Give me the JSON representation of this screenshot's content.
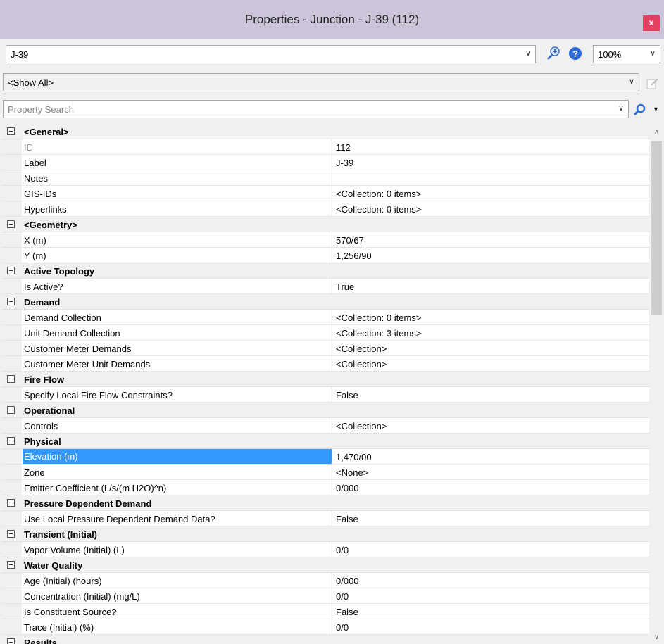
{
  "window": {
    "title": "Properties - Junction - J-39 (112)",
    "close_label": "x"
  },
  "toolbar": {
    "element_selector_value": "J-39",
    "zoom_value": "100%",
    "filter_value": "<Show All>",
    "search_placeholder": "Property Search"
  },
  "rows": [
    {
      "type": "category",
      "name": "<General>"
    },
    {
      "type": "property",
      "name": "ID",
      "value": "112",
      "disabled": true
    },
    {
      "type": "property",
      "name": "Label",
      "value": "J-39"
    },
    {
      "type": "property",
      "name": "Notes",
      "value": ""
    },
    {
      "type": "property",
      "name": "GIS-IDs",
      "value": "<Collection: 0 items>"
    },
    {
      "type": "property",
      "name": "Hyperlinks",
      "value": "<Collection: 0 items>"
    },
    {
      "type": "category",
      "name": "<Geometry>"
    },
    {
      "type": "property",
      "name": "X (m)",
      "value": "570/67"
    },
    {
      "type": "property",
      "name": "Y (m)",
      "value": "1,256/90"
    },
    {
      "type": "category",
      "name": "Active Topology"
    },
    {
      "type": "property",
      "name": "Is Active?",
      "value": "True"
    },
    {
      "type": "category",
      "name": "Demand"
    },
    {
      "type": "property",
      "name": "Demand Collection",
      "value": "<Collection: 0 items>"
    },
    {
      "type": "property",
      "name": "Unit Demand Collection",
      "value": "<Collection: 3 items>"
    },
    {
      "type": "property",
      "name": "Customer Meter Demands",
      "value": "<Collection>"
    },
    {
      "type": "property",
      "name": "Customer Meter Unit Demands",
      "value": "<Collection>"
    },
    {
      "type": "category",
      "name": "Fire Flow"
    },
    {
      "type": "property",
      "name": "Specify Local Fire Flow Constraints?",
      "value": "False"
    },
    {
      "type": "category",
      "name": "Operational"
    },
    {
      "type": "property",
      "name": "Controls",
      "value": "<Collection>"
    },
    {
      "type": "category",
      "name": "Physical"
    },
    {
      "type": "property",
      "name": "Elevation (m)",
      "value": "1,470/00",
      "selected": true
    },
    {
      "type": "property",
      "name": "Zone",
      "value": "<None>"
    },
    {
      "type": "property",
      "name": "Emitter Coefficient (L/s/(m H2O)^n)",
      "value": "0/000"
    },
    {
      "type": "category",
      "name": "Pressure Dependent Demand"
    },
    {
      "type": "property",
      "name": "Use Local Pressure Dependent Demand Data?",
      "value": "False"
    },
    {
      "type": "category",
      "name": "Transient (Initial)"
    },
    {
      "type": "property",
      "name": "Vapor Volume (Initial) (L)",
      "value": "0/0"
    },
    {
      "type": "category",
      "name": "Water Quality"
    },
    {
      "type": "property",
      "name": "Age (Initial) (hours)",
      "value": "0/000"
    },
    {
      "type": "property",
      "name": "Concentration (Initial) (mg/L)",
      "value": "0/0"
    },
    {
      "type": "property",
      "name": "Is Constituent Source?",
      "value": "False"
    },
    {
      "type": "property",
      "name": "Trace (Initial) (%)",
      "value": "0/0"
    },
    {
      "type": "category",
      "name": "Results"
    }
  ]
}
